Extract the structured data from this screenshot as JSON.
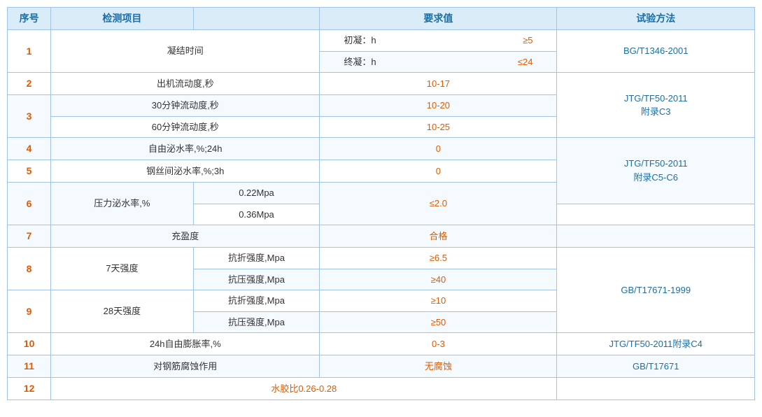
{
  "table": {
    "headers": [
      "序号",
      "检测项目",
      "要求值",
      "试验方法"
    ],
    "rows": [
      {
        "num": "1",
        "item": "凝结时间",
        "sub_items": null,
        "req_sub": [
          {
            "label": "初凝：h",
            "value": "≥5"
          },
          {
            "label": "终凝：h",
            "value": "≤24"
          }
        ],
        "req_single": null,
        "method": "BG/T1346-2001",
        "has_sub_cols": true
      },
      {
        "num": "2",
        "item": "出机流动度,秒",
        "req_single": "10-17",
        "method": null,
        "method_shared": "JTG/TF50-2011\n附录C3"
      },
      {
        "num": "3",
        "item_sub": [
          "30分钟流动度,秒",
          "60分钟流动度,秒"
        ],
        "req_sub_single": [
          "10-20",
          "10-25"
        ],
        "method": null
      },
      {
        "num": "4",
        "item": "自由泌水率,%;24h",
        "req_single": "0",
        "method": null
      },
      {
        "num": "5",
        "item": "钢丝间泌水率,%;3h",
        "req_single": "0",
        "method_shared2": "JTG/TF50-2011\n附录C5-C6"
      },
      {
        "num": "6",
        "item": "压力泌水率,%",
        "req_pressure": [
          {
            "label": "0.22Mpa"
          },
          {
            "label": "0.36Mpa"
          }
        ],
        "req_pressure_val": "≤2.0",
        "method": null
      },
      {
        "num": "7",
        "item": "充盈度",
        "req_single": "合格",
        "method": null
      },
      {
        "num": "8",
        "item": "7天强度",
        "item_sub": [
          "抗折强度,Mpa",
          "抗压强度,Mpa"
        ],
        "req_sub_single": [
          "≥6.5",
          "≥40"
        ],
        "method_shared3": "GB/T17671-1999"
      },
      {
        "num": "9",
        "item": "28天强度",
        "item_sub": [
          "抗折强度,Mpa",
          "抗压强度,Mpa"
        ],
        "req_sub_single": [
          "≥10",
          "≥50"
        ],
        "method": null
      },
      {
        "num": "10",
        "item": "24h自由膨胀率,%",
        "req_single": "0-3",
        "method": "JTG/TF50-2011附录C4"
      },
      {
        "num": "11",
        "item": "对钢筋腐蚀作用",
        "req_single": "无腐蚀",
        "method": "GB/T17671"
      },
      {
        "num": "12",
        "item": null,
        "req_single": "水胶比0.26-0.28",
        "method": null
      }
    ]
  }
}
